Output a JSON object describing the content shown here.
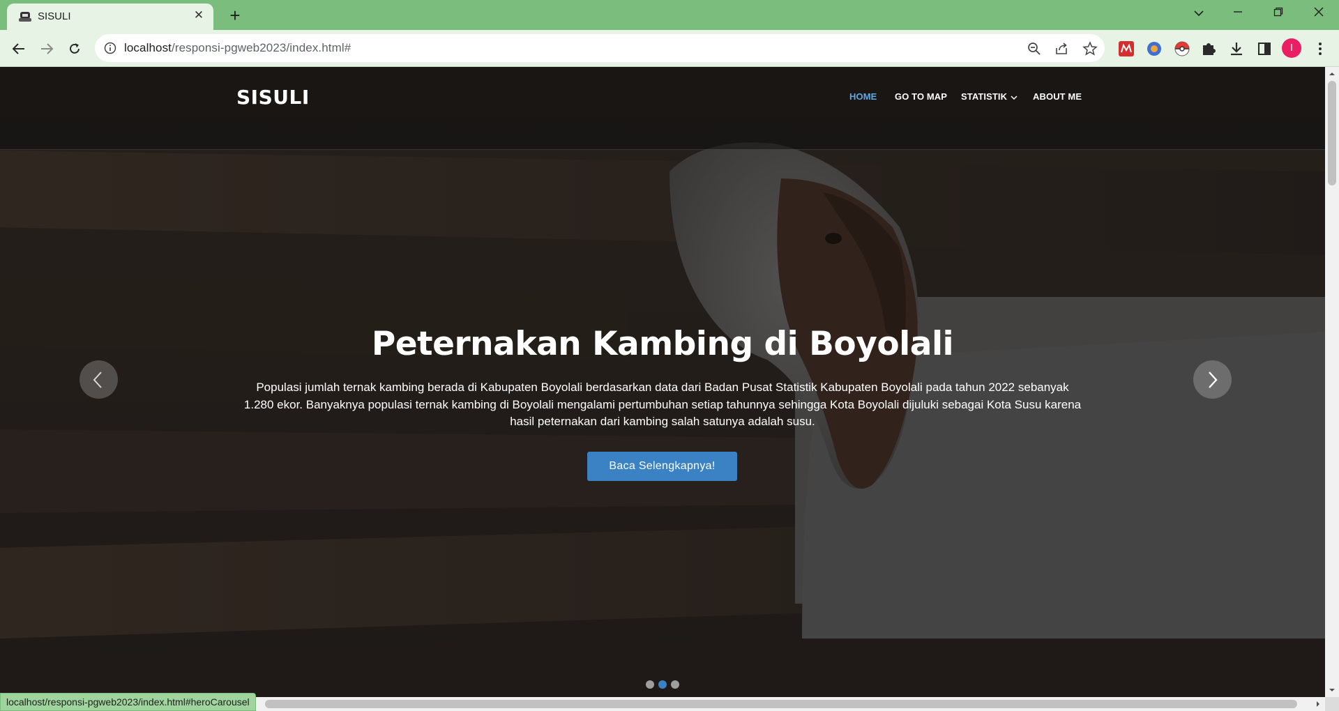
{
  "browser": {
    "tab_title": "SISULI",
    "url_host": "localhost",
    "url_path": "/responsi-pgweb2023/index.html#",
    "avatar_initial": "I",
    "status_url": "localhost/responsi-pgweb2023/index.html#heroCarousel",
    "theme_color": "#7bbd7d"
  },
  "site": {
    "logo": "SISULI",
    "menu": [
      {
        "label": "HOME",
        "active": true
      },
      {
        "label": "GO TO MAP"
      },
      {
        "label": "STATISTIK"
      },
      {
        "label": "ABOUT ME"
      }
    ],
    "accent_color": "#3b82c4"
  },
  "hero": {
    "title": "Peternakan Kambing di Boyolali",
    "text": "Populasi jumlah ternak kambing berada di Kabupaten Boyolali berdasarkan data dari Badan Pusat Statistik Kabupaten Boyolali pada tahun 2022 sebanyak 1.280 ekor. Banyaknya populasi ternak kambing di Boyolali mengalami pertumbuhan setiap tahunnya sehingga Kota Boyolali dijuluki sebagai Kota Susu karena hasil peternakan dari kambing salah satunya adalah susu.",
    "cta": "Baca Selengkapnya!",
    "slide_count": 3,
    "active_slide": 2
  },
  "icons": [
    "back-icon",
    "forward-icon",
    "reload-icon",
    "info-icon",
    "zoom-icon",
    "share-icon",
    "star-icon",
    "extensions-icon",
    "download-icon",
    "sidepanel-icon",
    "menu-icon",
    "chevron-left-icon",
    "chevron-right-icon"
  ]
}
